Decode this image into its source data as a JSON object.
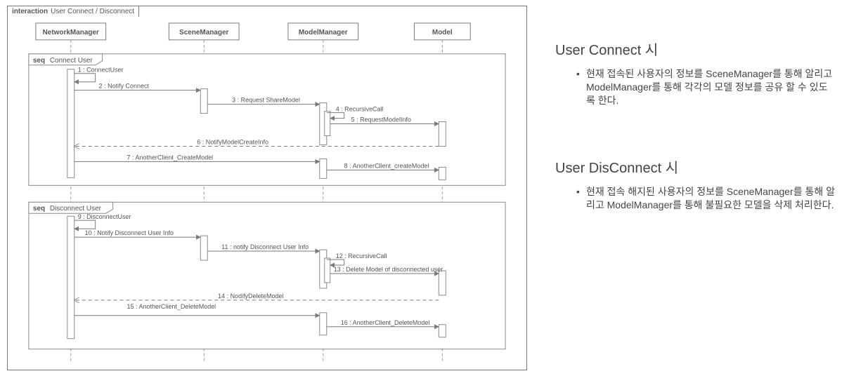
{
  "frame_kind": "interaction",
  "frame_name": "User Connect / Disconnect",
  "lifelines": [
    "NetworkManager",
    "SceneManager",
    "ModelManager",
    "Model"
  ],
  "seq1_label": "seq",
  "seq1_name": "Connect User",
  "seq2_label": "seq",
  "seq2_name": "Disconnect User",
  "messages": {
    "m1": "1 : ConnectUser",
    "m2": "2 : Notify Connect",
    "m3": "3 : Request ShareModel",
    "m4": "4 : RecursiveCall",
    "m5": "5 : RequestModelInfo",
    "m6": "6 : NotifyModelCreateInfo",
    "m7": "7 : AnotherClient_CreateModel",
    "m8": "8 : AnotherClient_createModel",
    "m9": "9 : DisconnectUser",
    "m10": "10 : Notify Disconnect User Info",
    "m11": "11 : notify Disconnect User Info",
    "m12": "12 : RecursiveCall",
    "m13": "13 : Delete Model of disconnected user",
    "m14": "14 : NodifyDeleteModel",
    "m15": "15 : AnotherClient_DeleteModel",
    "m16": "16 : AnotherClient_DeleteModel"
  },
  "right": {
    "h1": "User Connect 시",
    "p1": "현재 접속된 사용자의 정보를 SceneManager를 통해 알리고 ModelManager를 통해 각각의 모델 정보를 공유 할 수 있도록 한다.",
    "h2": "User DisConnect 시",
    "p2": "현재 접속 해지된 사용자의 정보를 SceneManager를 통해 알리고 ModelManager를 통해 불필요한 모델을 삭제 처리한다."
  }
}
